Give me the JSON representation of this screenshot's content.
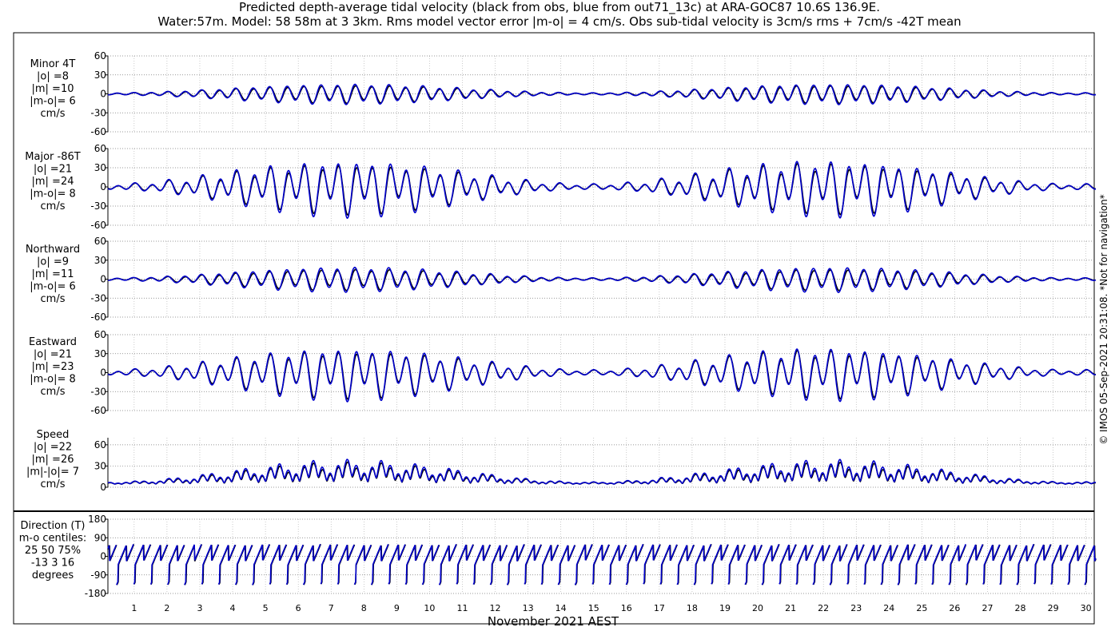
{
  "title_line1": "Predicted depth-average tidal velocity (black from obs, blue from out71_13c) at ARA-GOC87 10.6S 136.9E.",
  "title_line2": "Water:57m. Model: 58 58m at 3 3km. Rms model vector error |m-o| = 4 cm/s. Obs sub-tidal velocity is 3cm/s rms + 7cm/s -42T mean",
  "credit": "© IMOS 05-Sep-2021 20:31:08. *Not for navigation*",
  "colors": {
    "obs": "#000000",
    "model": "#0000cc",
    "grid": "#888888"
  },
  "chart_data": [
    {
      "type": "line",
      "panel": "minor",
      "labels": [
        "Minor 4T",
        "|o| =8",
        "|m| =10",
        "|m-o|= 6",
        "cm/s"
      ],
      "ylim": [
        -60,
        60
      ],
      "yticks": [
        "60",
        "30",
        "0",
        "-30",
        "-60"
      ],
      "yvals": [
        60,
        30,
        0,
        -30,
        -60
      ],
      "series": [
        {
          "name": "obs",
          "amp1": 12,
          "amp2": 3,
          "phase": 0.3,
          "offset": 0
        },
        {
          "name": "model",
          "amp1": 14,
          "amp2": 3,
          "phase": 0.5,
          "offset": 0
        }
      ]
    },
    {
      "type": "line",
      "panel": "major",
      "labels": [
        "Major -86T",
        "|o| =21",
        "|m| =24",
        "|m-o|= 8",
        "cm/s"
      ],
      "ylim": [
        -60,
        60
      ],
      "yticks": [
        "60",
        "30",
        "0",
        "-30",
        "-60"
      ],
      "yvals": [
        60,
        30,
        0,
        -30,
        -60
      ],
      "series": [
        {
          "name": "obs",
          "amp1": 30,
          "amp2": 14,
          "phase": 0.0,
          "offset": 0
        },
        {
          "name": "model",
          "amp1": 34,
          "amp2": 15,
          "phase": 0.1,
          "offset": 0
        }
      ]
    },
    {
      "type": "line",
      "panel": "north",
      "labels": [
        "Northward",
        "|o| =9",
        "|m| =11",
        "|m-o|= 6",
        "cm/s"
      ],
      "ylim": [
        -60,
        60
      ],
      "yticks": [
        "60",
        "30",
        "0",
        "-30",
        "-60"
      ],
      "yvals": [
        60,
        30,
        0,
        -30,
        -60
      ],
      "series": [
        {
          "name": "obs",
          "amp1": 14,
          "amp2": 4,
          "phase": 0.4,
          "offset": 0
        },
        {
          "name": "model",
          "amp1": 17,
          "amp2": 4,
          "phase": 0.6,
          "offset": 0
        }
      ]
    },
    {
      "type": "line",
      "panel": "east",
      "labels": [
        "Eastward",
        "|o| =21",
        "|m| =23",
        "|m-o|= 8",
        "cm/s"
      ],
      "ylim": [
        -60,
        60
      ],
      "yticks": [
        "60",
        "30",
        "0",
        "-30",
        "-60"
      ],
      "yvals": [
        60,
        30,
        0,
        -30,
        -60
      ],
      "series": [
        {
          "name": "obs",
          "amp1": 29,
          "amp2": 13,
          "phase": 0.0,
          "offset": 0
        },
        {
          "name": "model",
          "amp1": 32,
          "amp2": 14,
          "phase": 0.1,
          "offset": 0
        }
      ]
    },
    {
      "type": "line",
      "panel": "speed",
      "labels": [
        "Speed",
        "|o| =22",
        "|m| =26",
        "|m|-|o|= 7",
        "cm/s"
      ],
      "ylim": [
        0,
        70
      ],
      "yticks": [
        "60",
        "30",
        "0"
      ],
      "yvals": [
        60,
        30,
        0
      ],
      "series": [
        {
          "name": "obs",
          "amp1": 30,
          "amp2": 12,
          "phase": 0.0,
          "offset": 0
        },
        {
          "name": "model",
          "amp1": 34,
          "amp2": 13,
          "phase": 0.1,
          "offset": 0
        }
      ]
    },
    {
      "type": "line",
      "panel": "direction",
      "labels": [
        "Direction (T)",
        "m-o centiles:",
        "25  50  75%",
        "-13   3  16",
        "degrees"
      ],
      "ylim": [
        -180,
        180
      ],
      "yticks": [
        "180",
        "90",
        "0",
        "-90",
        "-180"
      ],
      "yvals": [
        180,
        90,
        0,
        -90,
        -180
      ],
      "series": [
        {
          "name": "obs",
          "phase": 0.0
        },
        {
          "name": "model",
          "phase": 0.15
        }
      ]
    }
  ],
  "xaxis": {
    "label": "November 2021 AEST",
    "range_days": [
      0.2,
      30.3
    ],
    "ticks": [
      "1",
      "2",
      "3",
      "4",
      "5",
      "6",
      "7",
      "8",
      "9",
      "10",
      "11",
      "12",
      "13",
      "14",
      "15",
      "16",
      "17",
      "18",
      "19",
      "20",
      "21",
      "22",
      "23",
      "24",
      "25",
      "26",
      "27",
      "28",
      "29",
      "30"
    ]
  }
}
